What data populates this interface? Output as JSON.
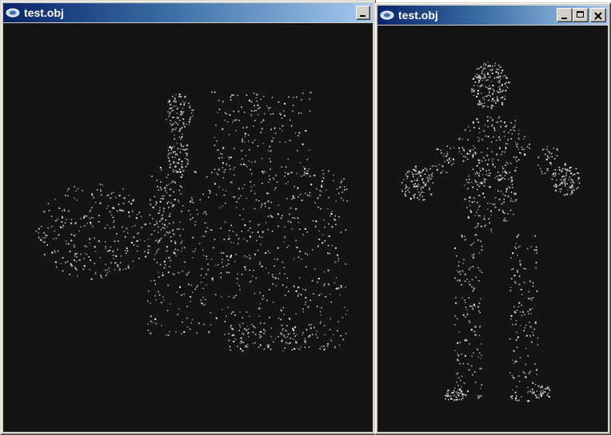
{
  "windows": [
    {
      "title": "test.obj",
      "buttons": [
        "minimize"
      ],
      "scene": "point-cloud"
    },
    {
      "title": "test.obj",
      "buttons": [
        "minimize",
        "maximize",
        "close"
      ],
      "scene": "point-cloud"
    }
  ],
  "colors": {
    "titlebar_start": "#0a246a",
    "titlebar_end": "#a6caf0",
    "viewport_bg": "#141414",
    "window_face": "#d4d0c8"
  },
  "icons": {
    "app": "app-window-icon",
    "minimize": "minimize-icon",
    "maximize": "maximize-icon",
    "close": "close-icon"
  }
}
